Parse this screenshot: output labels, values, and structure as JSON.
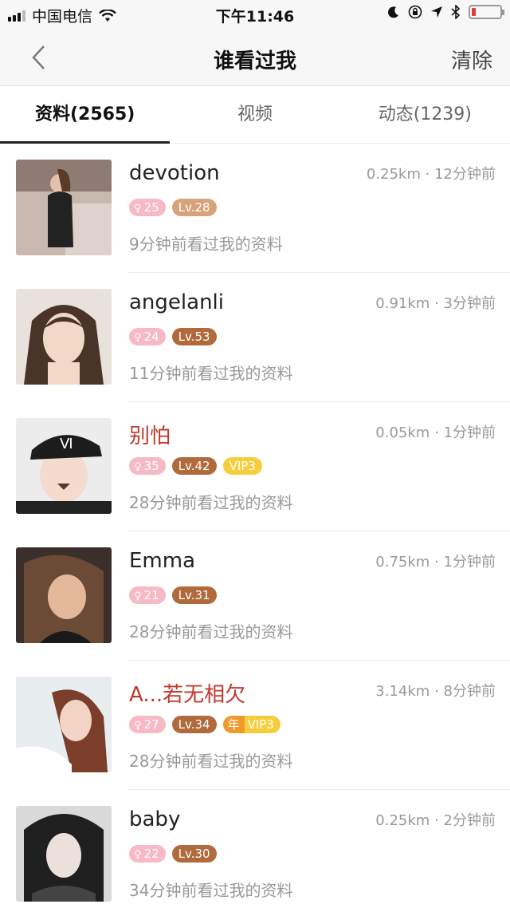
{
  "status_bar": {
    "carrier": "中国电信",
    "time": "下午11:46"
  },
  "nav": {
    "title": "谁看过我",
    "clear_label": "清除"
  },
  "tabs": [
    {
      "label": "资料(2565)",
      "active": true
    },
    {
      "label": "视频",
      "active": false
    },
    {
      "label": "动态(1239)",
      "active": false
    }
  ],
  "visitors": [
    {
      "name": "devotion",
      "vip_name": false,
      "distance": "0.25km",
      "ago": "12分钟前",
      "age": "25",
      "level": "Lv.28",
      "badges_extra": [],
      "desc": "9分钟前看过我的资料"
    },
    {
      "name": "angelanli",
      "vip_name": false,
      "distance": "0.91km",
      "ago": "3分钟前",
      "age": "24",
      "level": "Lv.53",
      "badges_extra": [],
      "desc": "11分钟前看过我的资料"
    },
    {
      "name": "别怕",
      "vip_name": true,
      "distance": "0.05km",
      "ago": "1分钟前",
      "age": "35",
      "level": "Lv.42",
      "vip_badge": "VIP3",
      "desc": "28分钟前看过我的资料"
    },
    {
      "name": "Emma",
      "vip_name": false,
      "distance": "0.75km",
      "ago": "1分钟前",
      "age": "21",
      "level": "Lv.31",
      "desc": "28分钟前看过我的资料"
    },
    {
      "name": "A...若无相欠",
      "vip_name": true,
      "distance": "3.14km",
      "ago": "8分钟前",
      "age": "27",
      "level": "Lv.34",
      "year_badge": "年",
      "vip_badge": "VIP3",
      "desc": "28分钟前看过我的资料"
    },
    {
      "name": "baby",
      "vip_name": false,
      "distance": "0.25km",
      "ago": "2分钟前",
      "age": "22",
      "level": "Lv.30",
      "desc": "34分钟前看过我的资料"
    }
  ],
  "meta_separator": "·",
  "age_symbol": "♀"
}
